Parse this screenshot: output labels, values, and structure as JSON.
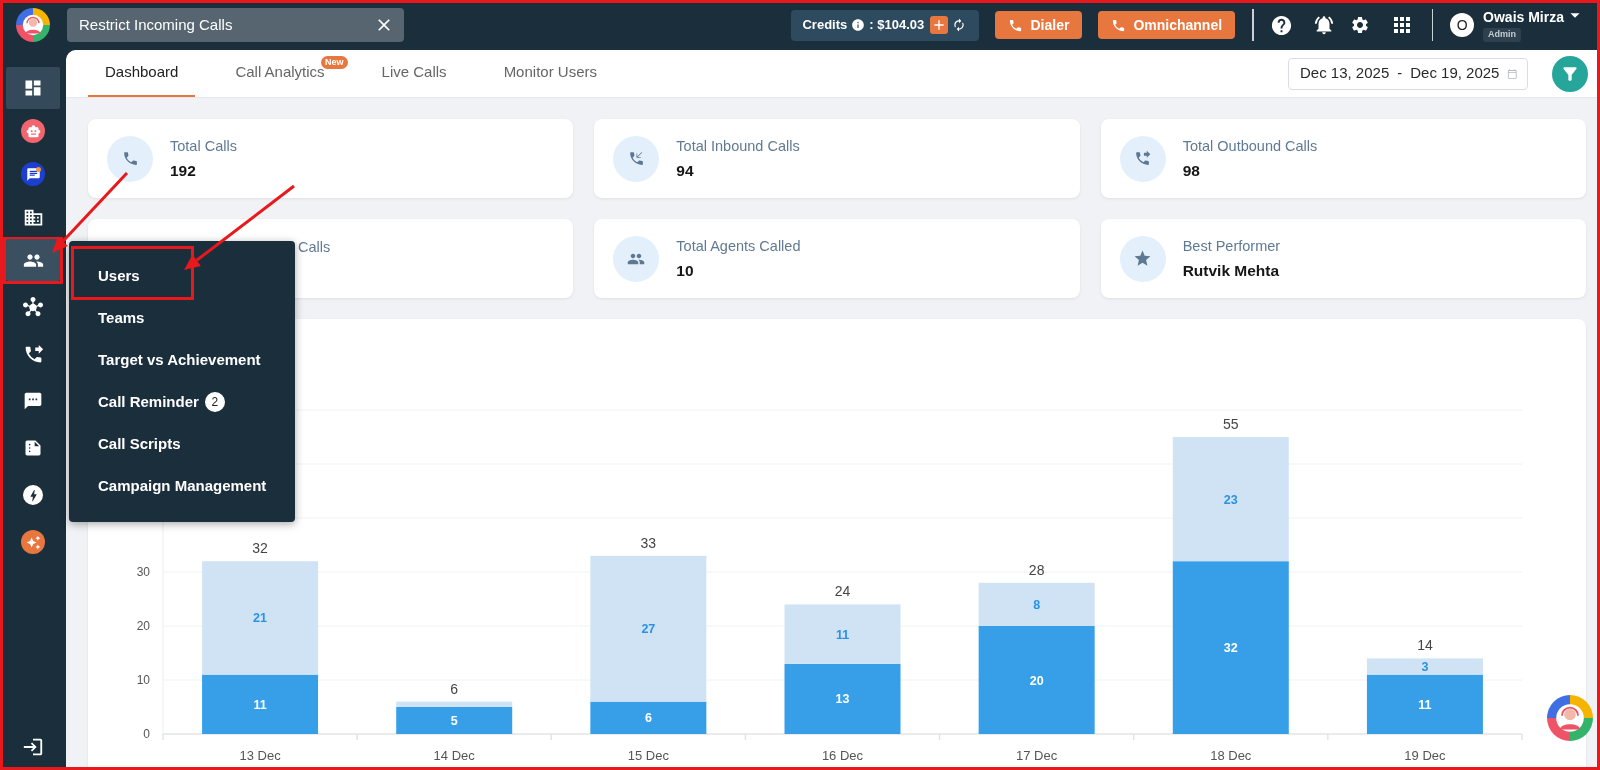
{
  "top_bar": {
    "open_tab": {
      "title": "Restrict Incoming Calls"
    },
    "credits": {
      "label": "Credits",
      "amount": ": $104.03"
    },
    "buttons": [
      {
        "label": "Dialer"
      },
      {
        "label": "Omnichannel"
      }
    ],
    "user": {
      "initial": "O",
      "name": "Owais Mirza",
      "role": "Admin"
    }
  },
  "sidebar": {
    "items": [
      {
        "selected": true,
        "expanded": false,
        "highlighted": false
      },
      {
        "selected": false,
        "expanded": false,
        "highlighted": false
      },
      {
        "selected": false,
        "expanded": false,
        "highlighted": false
      },
      {
        "selected": false,
        "expanded": false,
        "highlighted": false
      },
      {
        "selected": false,
        "expanded": true,
        "highlighted": true
      },
      {
        "selected": false,
        "expanded": false,
        "highlighted": false
      },
      {
        "selected": false,
        "expanded": false,
        "highlighted": false
      },
      {
        "selected": false,
        "expanded": false,
        "highlighted": false
      },
      {
        "selected": false,
        "expanded": false,
        "highlighted": false
      },
      {
        "selected": false,
        "expanded": false,
        "highlighted": false
      },
      {
        "selected": false,
        "expanded": false,
        "highlighted": false
      }
    ]
  },
  "tabs": [
    {
      "label": "Dashboard",
      "selected": true
    },
    {
      "label": "Call Analytics",
      "selected": false,
      "badge": "New"
    },
    {
      "label": "Live Calls",
      "selected": false
    },
    {
      "label": "Monitor Users",
      "selected": false
    }
  ],
  "date_range": {
    "start": "Dec 13, 2025",
    "separator": "-",
    "end": "Dec 19, 2025"
  },
  "stats": [
    {
      "kind": "stat",
      "label": "Total Calls",
      "value": "192"
    },
    {
      "kind": "stat",
      "label": "Total Inbound Calls",
      "value": "94"
    },
    {
      "kind": "stat",
      "label": "Total Outbound Calls",
      "value": "98"
    },
    {
      "kind": "covered",
      "label": "Calls"
    },
    {
      "kind": "stat",
      "label": "Total Agents Called",
      "value": "10"
    },
    {
      "kind": "stat",
      "label": "Best Performer",
      "value": "Rutvik Mehta"
    }
  ],
  "menu": {
    "items": [
      {
        "label": "Users",
        "highlighted": true
      },
      {
        "label": "Teams",
        "highlighted": false
      },
      {
        "label": "Target vs Achievement",
        "highlighted": false
      },
      {
        "label": "Call Reminder",
        "badge": "2",
        "highlighted": false
      },
      {
        "label": "Call Scripts",
        "highlighted": false
      },
      {
        "label": "Campaign Management",
        "highlighted": false
      }
    ]
  },
  "chart": {
    "chart_data": {
      "type": "bar",
      "categories": [
        "13 Dec",
        "14 Dec",
        "15 Dec",
        "16 Dec",
        "17 Dec",
        "18 Dec",
        "19 Dec"
      ],
      "series": [
        {
          "color": "#379fe8",
          "values": [
            11,
            5,
            6,
            13,
            20,
            32,
            11
          ]
        },
        {
          "color": "#cfe3f5",
          "values": [
            21,
            1,
            27,
            11,
            8,
            23,
            3
          ]
        }
      ],
      "ylim": [
        0,
        60
      ],
      "yticks": [
        0,
        10,
        20,
        30
      ],
      "grid": true,
      "stacked": true,
      "value_labels": [
        [
          "11",
          "5",
          "6",
          "13",
          "20",
          "32",
          "11"
        ],
        [
          "21",
          null,
          "27",
          "11",
          "8",
          "23",
          "3"
        ]
      ],
      "annotations": [
        {
          "x": "13 Dec",
          "y": 32,
          "text": "32"
        },
        {
          "x": "14 Dec",
          "y": 6,
          "text": "6"
        },
        {
          "x": "15 Dec",
          "y": 33,
          "text": "33"
        },
        {
          "x": "16 Dec",
          "y": 24,
          "text": "24"
        },
        {
          "x": "17 Dec",
          "y": 28,
          "text": "28"
        },
        {
          "x": "18 Dec",
          "y": 55,
          "text": "55"
        },
        {
          "x": "19 Dec",
          "y": 14,
          "text": "14"
        }
      ]
    }
  }
}
